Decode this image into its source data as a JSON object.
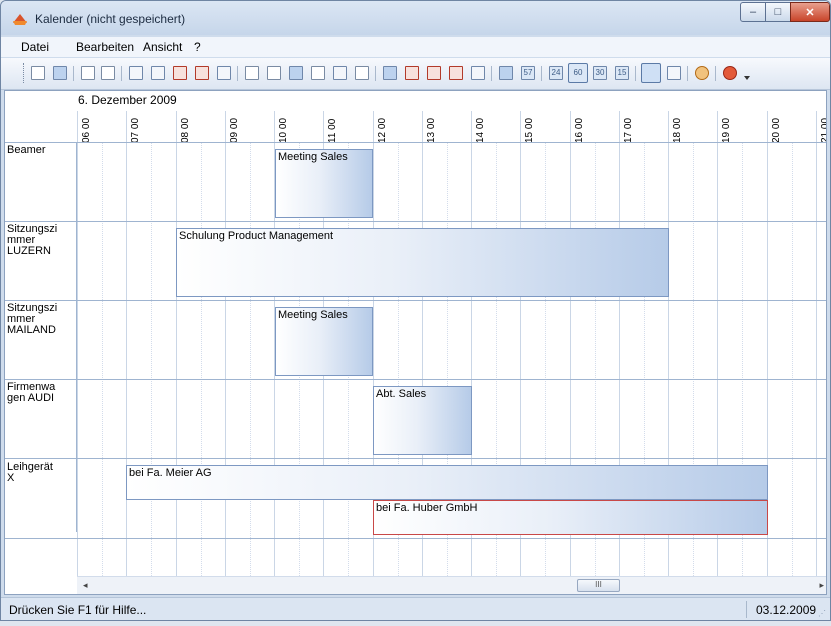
{
  "window": {
    "title": "Kalender (nicht gespeichert)"
  },
  "title_buttons": {
    "minimize": "–",
    "maximize": "□",
    "close": "✕"
  },
  "menu": [
    {
      "label": "Datei"
    },
    {
      "label": "Bearbeiten"
    },
    {
      "label": "Ansicht"
    },
    {
      "label": "?"
    }
  ],
  "toolbar": {
    "icons": [
      "open-folder-icon",
      "save-icon",
      "print-preview-icon",
      "print-icon",
      "insert-row-icon",
      "insert-column-icon",
      "delete-row-icon",
      "delete-column-icon",
      "copy-icon",
      "new-appointment-icon",
      "new-task-icon",
      "calendar-icon",
      "export-icon",
      "grid-icon",
      "window-icon",
      "day-view-icon",
      "week-view-icon",
      "month-view-icon",
      "timeline-view-icon",
      "schedule-icon",
      "table-icon",
      "date-icon",
      "zoom-24-icon",
      "zoom-60-icon",
      "zoom-30-icon",
      "zoom-15-icon",
      "vertical-view-icon",
      "horizontal-view-icon",
      "help-icon",
      "close-red-icon",
      "dropdown-arrow-icon"
    ],
    "num_labels": {
      "date": "57",
      "z24": "24",
      "z60": "60",
      "z30": "30",
      "z15": "15"
    }
  },
  "calendar": {
    "date": "6. Dezember 2009",
    "hours": [
      {
        "h": "06",
        "m": "00"
      },
      {
        "h": "07",
        "m": "00"
      },
      {
        "h": "08",
        "m": "00"
      },
      {
        "h": "09",
        "m": "00"
      },
      {
        "h": "10",
        "m": "00"
      },
      {
        "h": "11",
        "m": "00"
      },
      {
        "h": "12",
        "m": "00"
      },
      {
        "h": "13",
        "m": "00"
      },
      {
        "h": "14",
        "m": "00"
      },
      {
        "h": "15",
        "m": "00"
      },
      {
        "h": "16",
        "m": "00"
      },
      {
        "h": "17",
        "m": "00"
      },
      {
        "h": "18",
        "m": "00"
      },
      {
        "h": "19",
        "m": "00"
      },
      {
        "h": "20",
        "m": "00"
      },
      {
        "h": "21",
        "m": "00"
      }
    ],
    "resources": [
      {
        "label": "Beamer"
      },
      {
        "label": "Sitzungszi\nmmer\nLUZERN"
      },
      {
        "label": "Sitzungszi\nmmer\nMAILAND"
      },
      {
        "label": "Firmenwa\ngen AUDI"
      },
      {
        "label": "Leihgerät\nX"
      }
    ],
    "appointments": [
      {
        "title": "Meeting Sales",
        "resource": 0,
        "start": "10:00",
        "end": "12:00"
      },
      {
        "title": "Schulung Product Management",
        "resource": 1,
        "start": "08:00",
        "end": "18:00"
      },
      {
        "title": "Meeting Sales",
        "resource": 2,
        "start": "10:00",
        "end": "12:00"
      },
      {
        "title": "Abt. Sales",
        "resource": 3,
        "start": "12:00",
        "end": "14:00"
      },
      {
        "title": "bei Fa. Meier AG",
        "resource": 4,
        "start": "07:00",
        "end": "20:00"
      },
      {
        "title": "bei Fa. Huber GmbH",
        "resource": 4,
        "start": "12:00",
        "end": "20:00"
      }
    ]
  },
  "scrollbar": {
    "left_arrow": "◂",
    "right_arrow": "▸",
    "thumb": "III"
  },
  "status": {
    "help": "Drücken Sie F1 für Hilfe...",
    "date": "03.12.2009"
  }
}
